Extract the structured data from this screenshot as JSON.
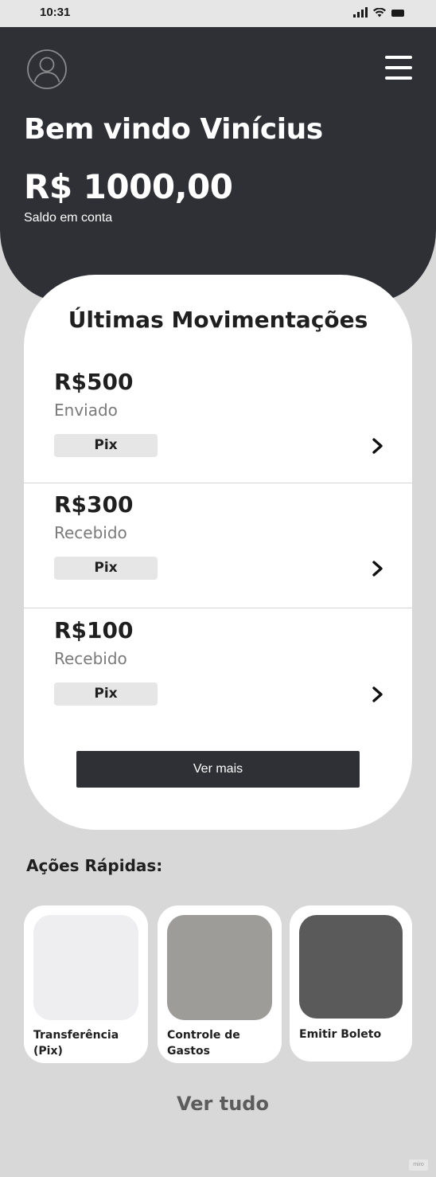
{
  "status_bar": {
    "time": "10:31"
  },
  "header": {
    "welcome": "Bem vindo Vinícius",
    "balance": "R$ 1000,00",
    "balance_label": "Saldo em conta"
  },
  "transactions": {
    "title": "Últimas Movimentações",
    "items": [
      {
        "amount": "R$500",
        "status": "Enviado",
        "type": "Pix"
      },
      {
        "amount": "R$300",
        "status": "Recebido",
        "type": "Pix"
      },
      {
        "amount": "R$100",
        "status": "Recebido",
        "type": "Pix"
      }
    ],
    "see_more": "Ver mais"
  },
  "quick_actions": {
    "title": "Ações Rápidas:",
    "items": [
      {
        "label": "Transferência (Pix)",
        "color": "#eeeef0"
      },
      {
        "label": "Controle de Gastos",
        "color": "#9d9c98"
      },
      {
        "label": "Emitir Boleto",
        "color": "#5a5a5a"
      }
    ],
    "see_all": "Ver tudo"
  },
  "watermark": "miro",
  "colors": {
    "header_bg": "#2f3036",
    "page_bg": "#d8d8d8",
    "card_bg": "#ffffff",
    "badge_bg": "#e6e6e6"
  }
}
